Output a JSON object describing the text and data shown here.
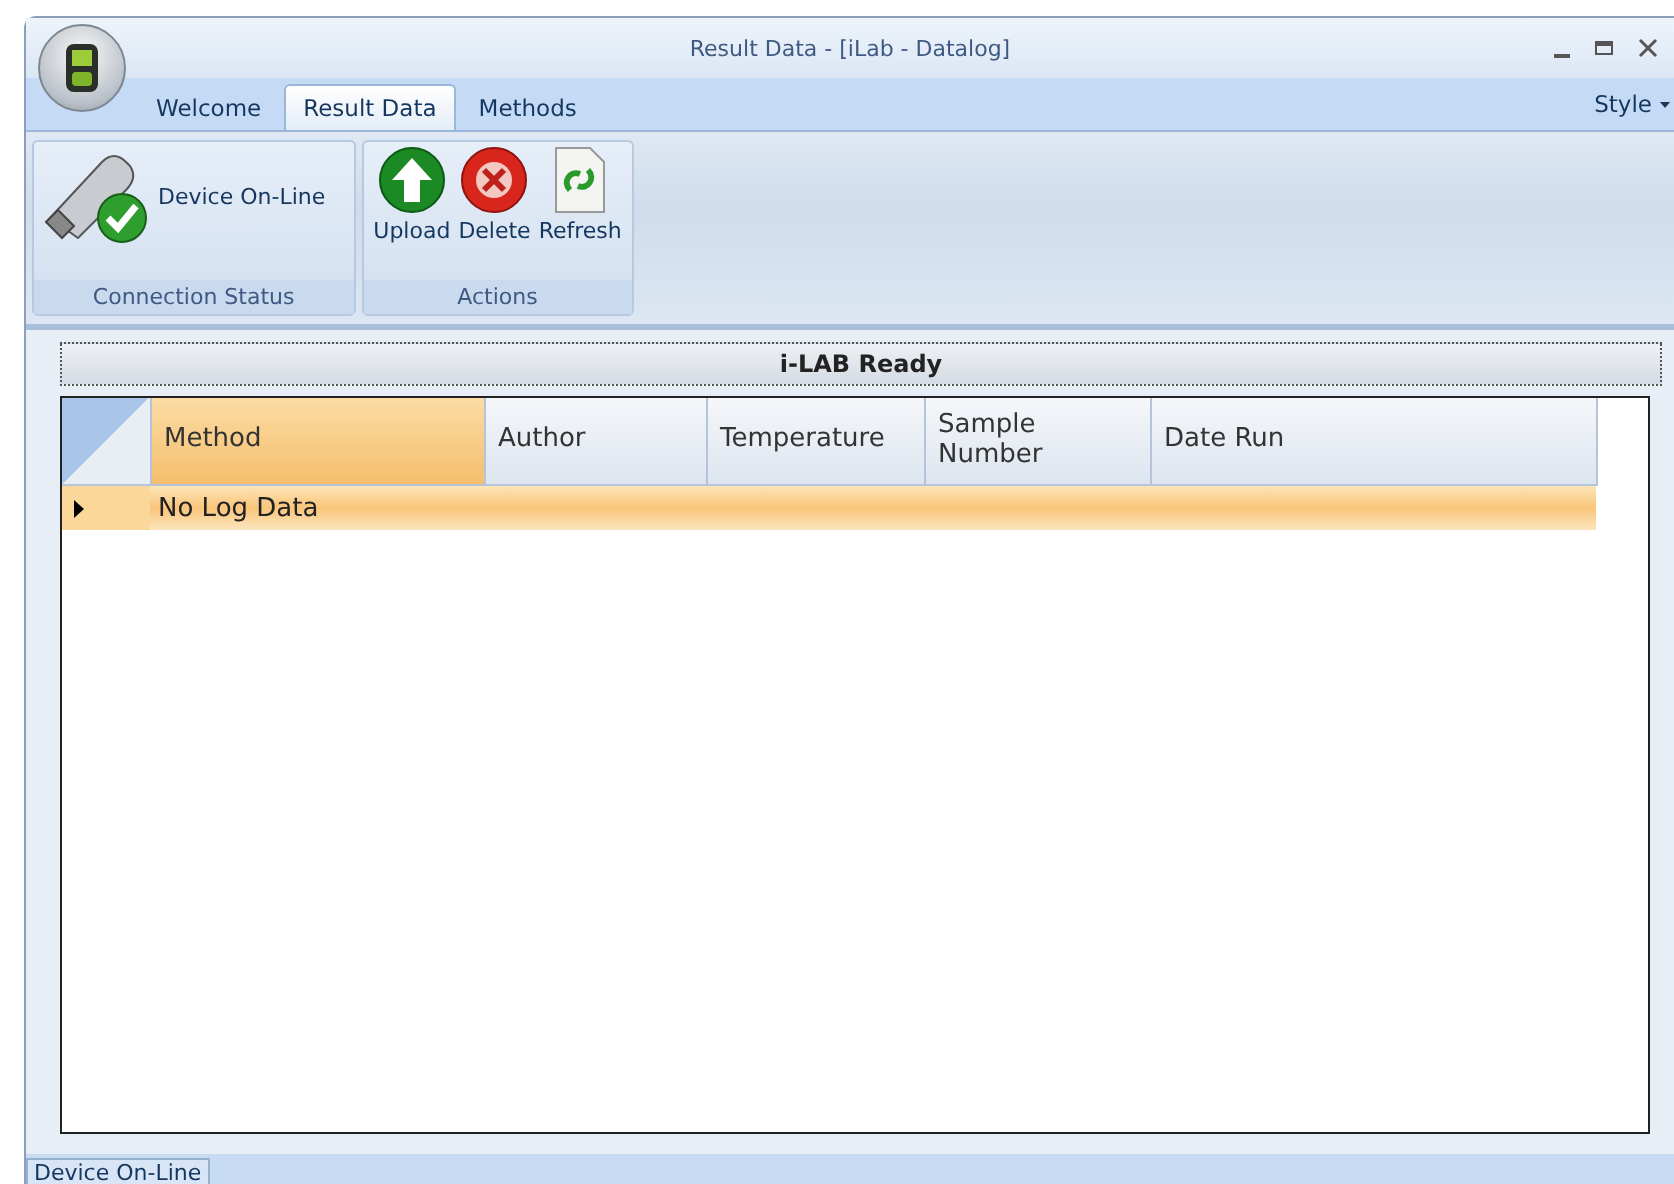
{
  "window": {
    "title": "Result Data - [iLab - Datalog]"
  },
  "tabs": [
    {
      "label": "Welcome",
      "selected": false
    },
    {
      "label": "Result Data",
      "selected": true
    },
    {
      "label": "Methods",
      "selected": false
    }
  ],
  "style_menu": {
    "label": "Style"
  },
  "ribbon_groups": [
    {
      "title": "Connection Status",
      "buttons": [
        {
          "label": "Device On-Line",
          "kind": "device"
        }
      ]
    },
    {
      "title": "Actions",
      "buttons": [
        {
          "label": "Upload",
          "kind": "upload"
        },
        {
          "label": "Delete",
          "kind": "delete"
        },
        {
          "label": "Refresh",
          "kind": "refresh"
        }
      ]
    }
  ],
  "panel": {
    "title": "i-LAB Ready"
  },
  "table": {
    "columns": [
      {
        "label": "Method",
        "selected": true
      },
      {
        "label": "Author",
        "selected": false
      },
      {
        "label": "Temperature",
        "selected": false
      },
      {
        "label": "Sample Number",
        "selected": false
      },
      {
        "label": "Date Run",
        "selected": false
      }
    ],
    "rows": [
      {
        "cells": [
          "No Log Data"
        ],
        "selected": true
      }
    ]
  },
  "status_bar": {
    "text": "Device On-Line"
  }
}
